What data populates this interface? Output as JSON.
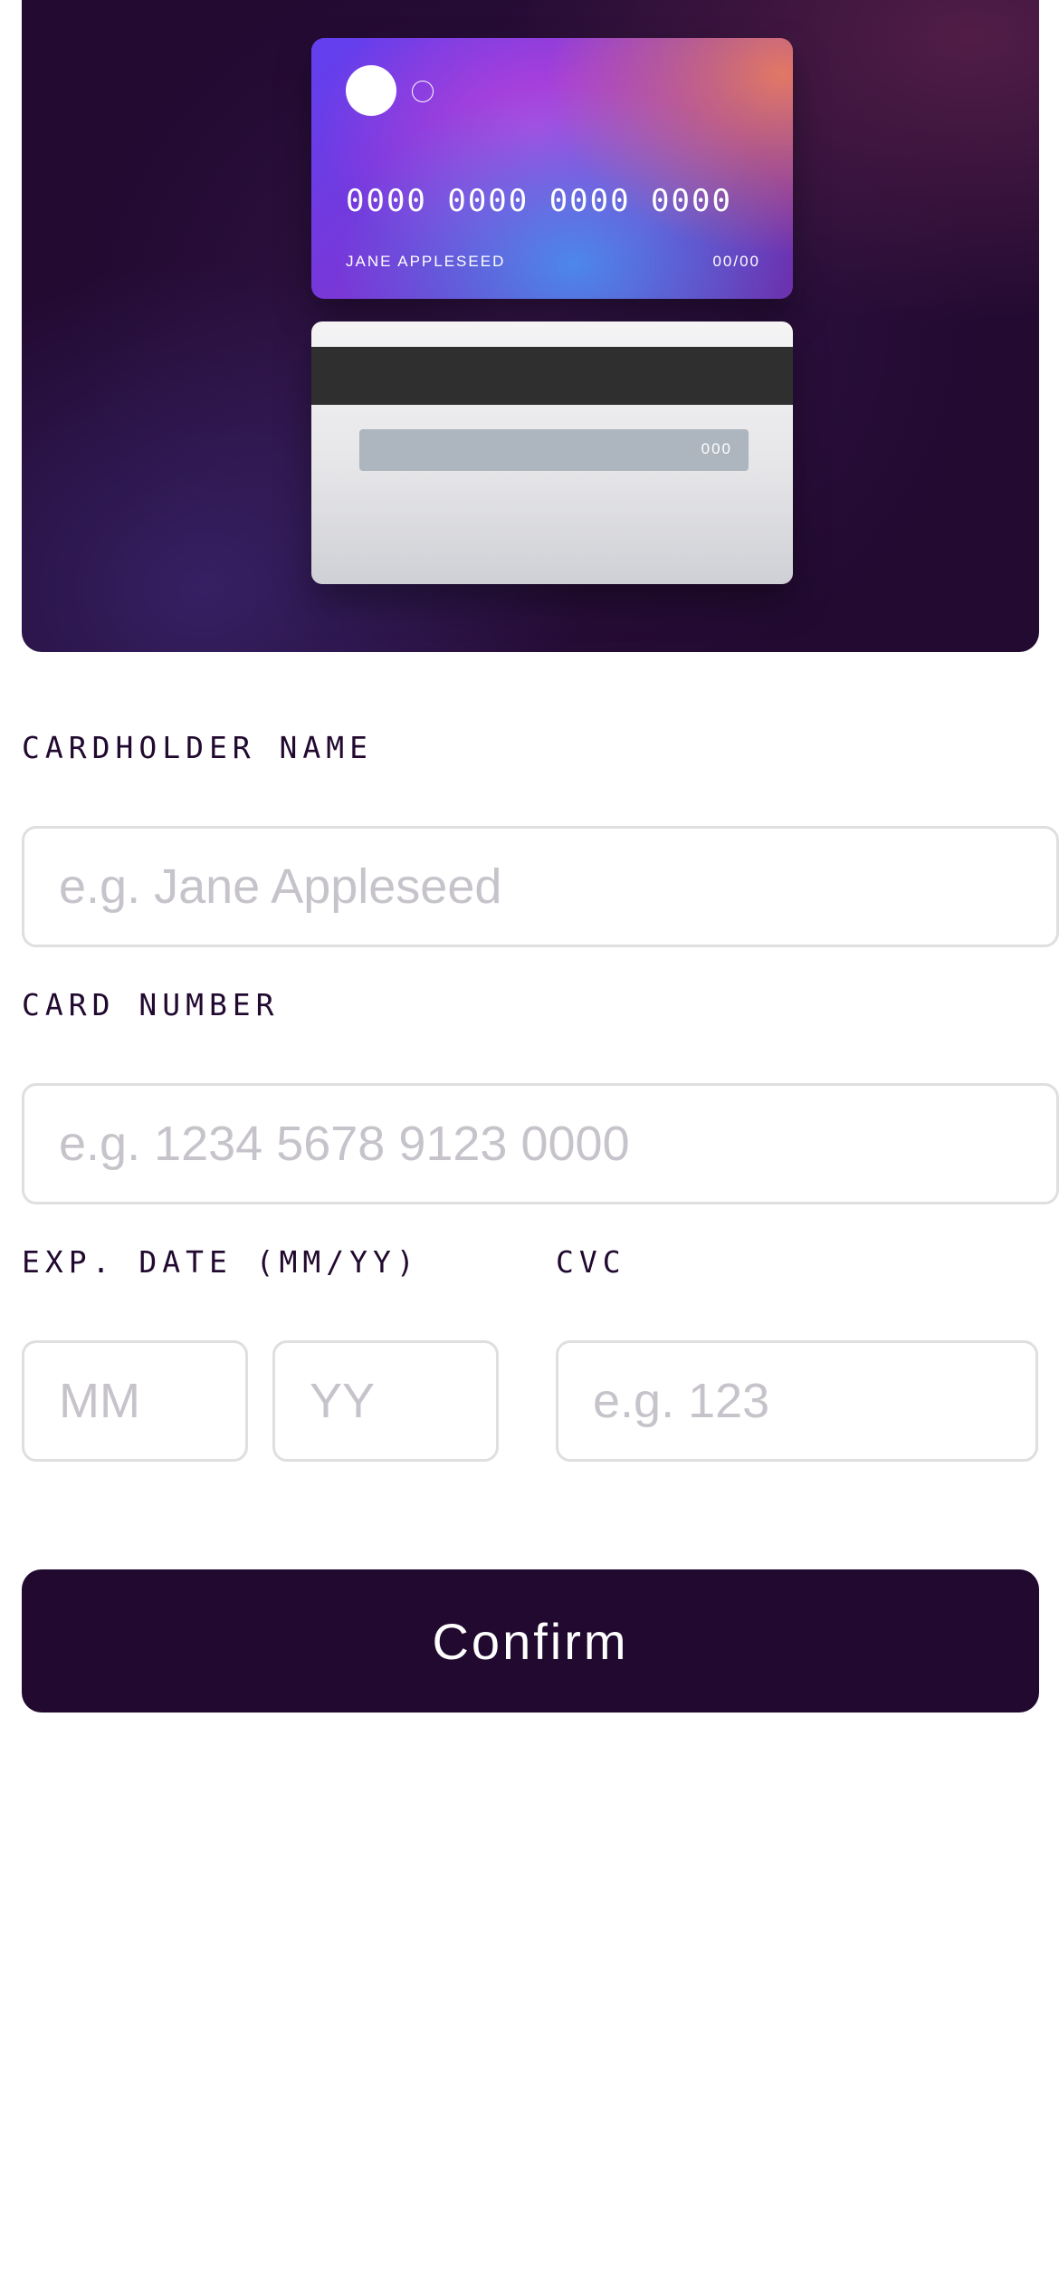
{
  "card_front": {
    "number": "0000 0000 0000 0000",
    "name": "JANE APPLESEED",
    "expiry": "00/00"
  },
  "card_back": {
    "cvc": "000"
  },
  "form": {
    "cardholder_label": "CARDHOLDER NAME",
    "cardholder_placeholder": "e.g. Jane Appleseed",
    "number_label": "CARD NUMBER",
    "number_placeholder": "e.g. 1234 5678 9123 0000",
    "expiry_label": "EXP. DATE (MM/YY)",
    "month_placeholder": "MM",
    "year_placeholder": "YY",
    "cvc_label": "CVC",
    "cvc_placeholder": "e.g. 123",
    "confirm_label": "Confirm"
  },
  "colors": {
    "hero_background": "#220a31",
    "button_background": "#21092f",
    "input_border": "#dfdee0",
    "placeholder": "#c7c3cb"
  }
}
